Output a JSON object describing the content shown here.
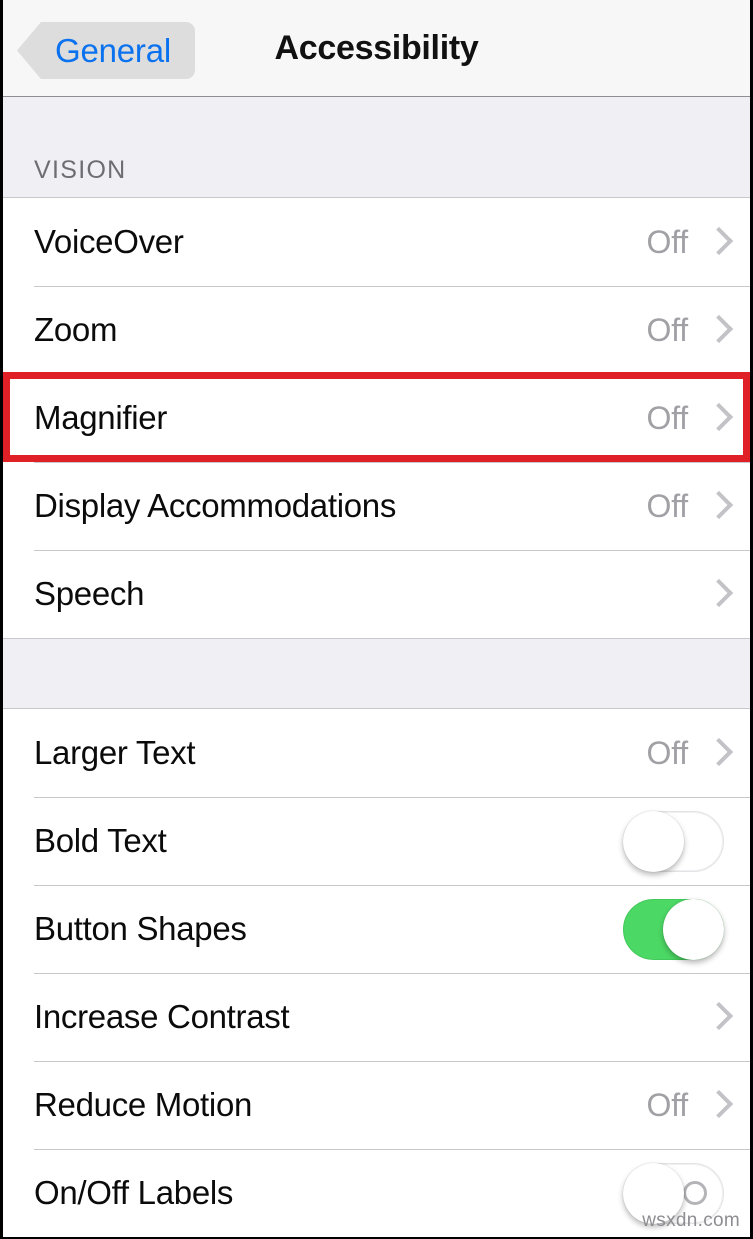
{
  "navbar": {
    "back_label": "General",
    "title": "Accessibility",
    "back_icon": "chevron-left-icon"
  },
  "sections": [
    {
      "header": "VISION",
      "rows": [
        {
          "label": "VoiceOver",
          "value": "Off",
          "accessory": "chevron"
        },
        {
          "label": "Zoom",
          "value": "Off",
          "accessory": "chevron"
        },
        {
          "label": "Magnifier",
          "value": "Off",
          "accessory": "chevron",
          "highlighted": true
        },
        {
          "label": "Display Accommodations",
          "value": "Off",
          "accessory": "chevron"
        },
        {
          "label": "Speech",
          "value": "",
          "accessory": "chevron"
        }
      ]
    },
    {
      "header": "",
      "rows": [
        {
          "label": "Larger Text",
          "value": "Off",
          "accessory": "chevron"
        },
        {
          "label": "Bold Text",
          "value": "",
          "accessory": "switch",
          "switch_state": "off"
        },
        {
          "label": "Button Shapes",
          "value": "",
          "accessory": "switch",
          "switch_state": "on"
        },
        {
          "label": "Increase Contrast",
          "value": "",
          "accessory": "chevron"
        },
        {
          "label": "Reduce Motion",
          "value": "Off",
          "accessory": "chevron"
        },
        {
          "label": "On/Off Labels",
          "value": "",
          "accessory": "switch-labeled",
          "switch_state": "off",
          "off_symbol": "O"
        }
      ]
    }
  ],
  "annotation": {
    "target_row": "Magnifier",
    "color": "#e02027"
  },
  "watermark": "wsxdn.com",
  "colors": {
    "accent_blue": "#0b72ef",
    "toggle_on_green": "#4cd864",
    "group_background": "#efeff4",
    "separator": "#c8c7cc",
    "value_gray": "#a0a0a5"
  }
}
